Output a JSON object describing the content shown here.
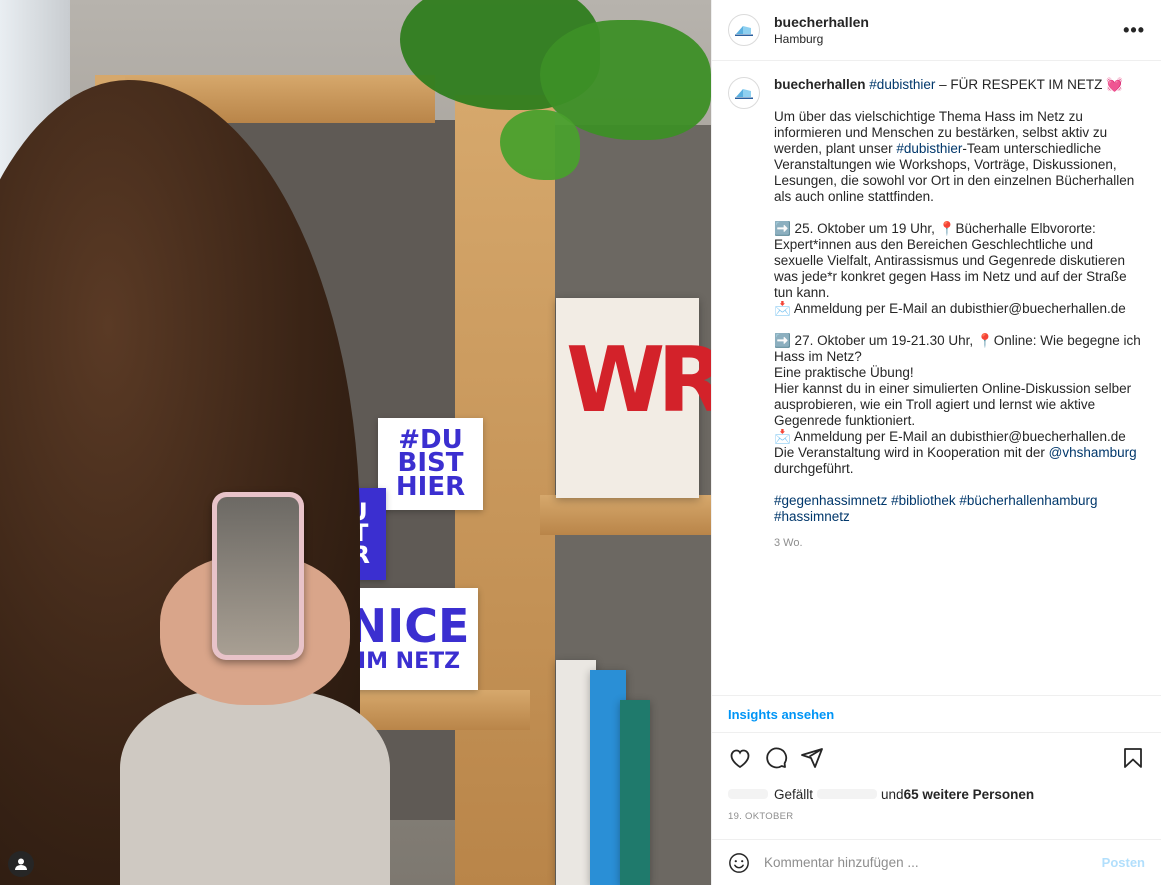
{
  "post": {
    "username": "buecherhallen",
    "location": "Hamburg",
    "more_label": "•••"
  },
  "caption": {
    "username": "buecherhallen",
    "hashtag_title": "#dubisthier",
    "title_rest": " – FÜR RESPEKT IM NETZ 💓",
    "p1_a": "Um über das vielschichtige Thema Hass im Netz zu informieren und Menschen zu bestärken, selbst aktiv zu werden, plant unser ",
    "p1_tag": "#dubisthier",
    "p1_b": "-Team unterschiedliche Veranstaltungen wie Workshops, Vorträge, Diskussionen, Lesungen, die sowohl vor Ort in den einzelnen Bücherhallen als auch online stattfinden.",
    "e1": "➡️ 25. Oktober um 19 Uhr, 📍Bücherhalle Elbvororte: Expert*innen aus den Bereichen Geschlechtliche und sexuelle Vielfalt, Antirassismus und Gegenrede diskutieren was jede*r konkret gegen Hass im Netz und auf der Straße tun kann.\n📩 Anmeldung per E-Mail an dubisthier@buecherhallen.de",
    "e2": "➡️ 27. Oktober um 19-21.30 Uhr, 📍Online: Wie begegne ich Hass im Netz?\nEine praktische Übung!\nHier kannst du in einer simulierten Online-Diskussion selber ausprobieren, wie ein Troll agiert und lernst wie aktive Gegenrede funktioniert.\n📩 Anmeldung per E-Mail an dubisthier@buecherhallen.de\nDie Veranstaltung wird in Kooperation mit der ",
    "e2_mention": "@vhshamburg",
    "e2_end": " durchgeführt.",
    "tags": [
      "#gegenhassimnetz",
      "#bibliothek",
      "#bücherhallenhamburg",
      "#hassimnetz"
    ],
    "ago": "3 Wo."
  },
  "insights_label": "Insights ansehen",
  "likes": {
    "prefix": "Gefällt",
    "middle": " und ",
    "others": "65 weitere Personen"
  },
  "date": "19. OKTOBER",
  "comment": {
    "placeholder": "Kommentar hinzufügen ...",
    "post_label": "Posten"
  },
  "photo": {
    "tile_dubisthier": "#DU\nBIST\nHIER",
    "tile_nice": "NICE",
    "tile_imnetz": "IM NETZ",
    "book_letters": "WR"
  },
  "icons": [
    "heart-icon",
    "comment-icon",
    "share-icon",
    "bookmark-icon",
    "emoji-icon",
    "user-icon"
  ]
}
